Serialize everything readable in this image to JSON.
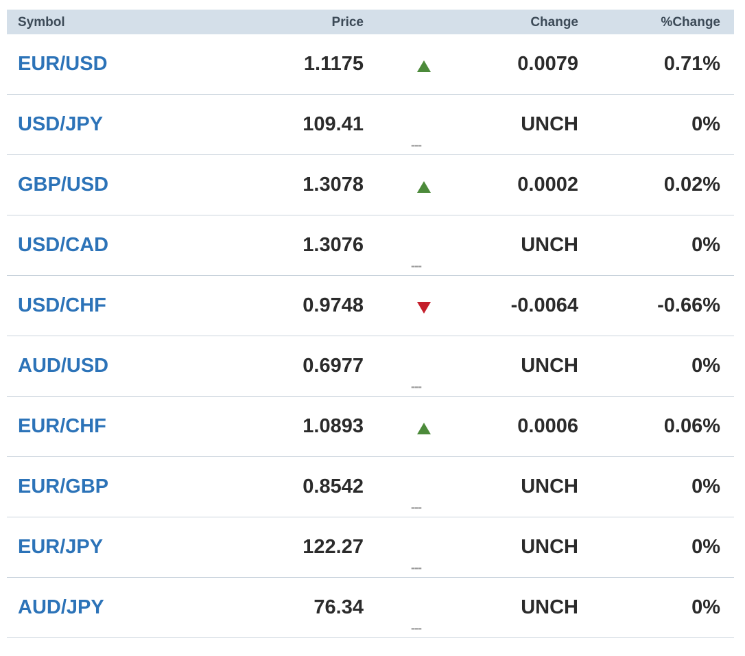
{
  "table": {
    "headers": {
      "symbol": "Symbol",
      "price": "Price",
      "change": "Change",
      "pct_change": "%Change"
    },
    "rows": [
      {
        "symbol": "EUR/USD",
        "price": "1.1175",
        "direction": "up",
        "indicator": "",
        "change": "0.0079",
        "pct_change": "0.71%"
      },
      {
        "symbol": "USD/JPY",
        "price": "109.41",
        "direction": "flat",
        "indicator": "---",
        "change": "UNCH",
        "pct_change": "0%"
      },
      {
        "symbol": "GBP/USD",
        "price": "1.3078",
        "direction": "up",
        "indicator": "",
        "change": "0.0002",
        "pct_change": "0.02%"
      },
      {
        "symbol": "USD/CAD",
        "price": "1.3076",
        "direction": "flat",
        "indicator": "---",
        "change": "UNCH",
        "pct_change": "0%"
      },
      {
        "symbol": "USD/CHF",
        "price": "0.9748",
        "direction": "down",
        "indicator": "",
        "change": "-0.0064",
        "pct_change": "-0.66%"
      },
      {
        "symbol": "AUD/USD",
        "price": "0.6977",
        "direction": "flat",
        "indicator": "---",
        "change": "UNCH",
        "pct_change": "0%"
      },
      {
        "symbol": "EUR/CHF",
        "price": "1.0893",
        "direction": "up",
        "indicator": "",
        "change": "0.0006",
        "pct_change": "0.06%"
      },
      {
        "symbol": "EUR/GBP",
        "price": "0.8542",
        "direction": "flat",
        "indicator": "---",
        "change": "UNCH",
        "pct_change": "0%"
      },
      {
        "symbol": "EUR/JPY",
        "price": "122.27",
        "direction": "flat",
        "indicator": "---",
        "change": "UNCH",
        "pct_change": "0%"
      },
      {
        "symbol": "AUD/JPY",
        "price": "76.34",
        "direction": "flat",
        "indicator": "---",
        "change": "UNCH",
        "pct_change": "0%"
      }
    ]
  },
  "colors": {
    "header_bg": "#d4dfe9",
    "symbol_link": "#2c73b8",
    "up": "#4c8a3a",
    "down": "#c41f2b",
    "flat": "#9a9a9a"
  },
  "icons": {
    "up": "triangle-up-icon",
    "down": "triangle-down-icon",
    "flat": "unchanged-dash-icon"
  }
}
